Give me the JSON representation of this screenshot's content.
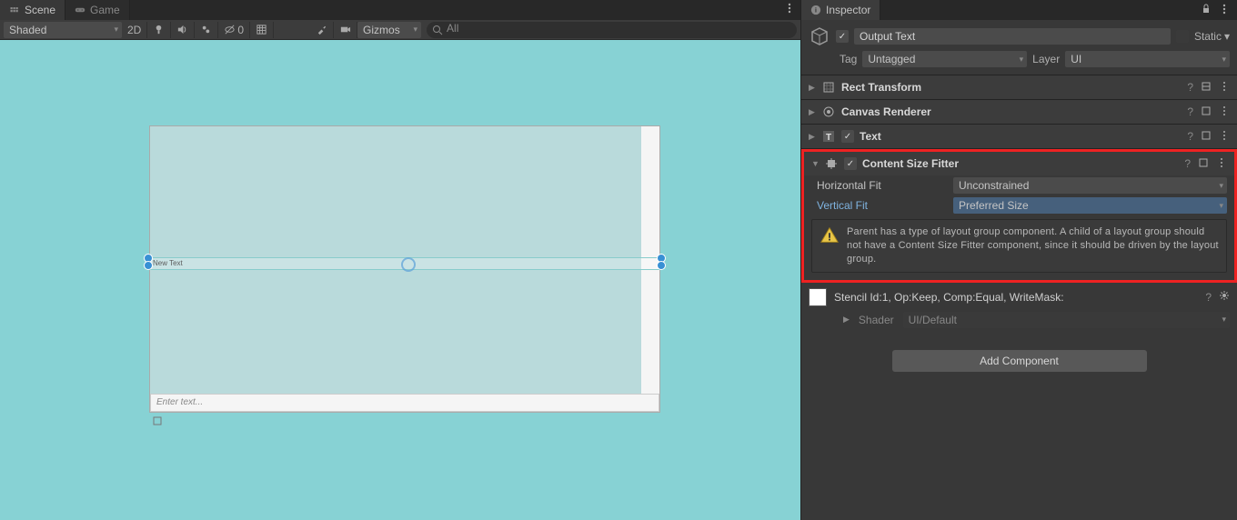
{
  "tabs": {
    "scene": "Scene",
    "game": "Game"
  },
  "toolbar": {
    "shading": "Shaded",
    "btn2d": "2D",
    "sky_hidden": "0",
    "gizmos": "Gizmos",
    "search_placeholder": "All"
  },
  "viewport": {
    "selected_text": "New Text",
    "input_placeholder": "Enter text..."
  },
  "inspector": {
    "title": "Inspector",
    "object_name": "Output Text",
    "static_label": "Static",
    "tag_label": "Tag",
    "tag_value": "Untagged",
    "layer_label": "Layer",
    "layer_value": "UI",
    "components": {
      "rect": "Rect Transform",
      "canvas_r": "Canvas Renderer",
      "text": "Text",
      "csf": "Content Size Fitter"
    },
    "csf": {
      "hfit_label": "Horizontal Fit",
      "hfit_value": "Unconstrained",
      "vfit_label": "Vertical Fit",
      "vfit_value": "Preferred Size",
      "warning": "Parent has a type of layout group component. A child of a layout group should not have a Content Size Fitter component, since it should be driven by the layout group."
    },
    "material": {
      "stencil": "Stencil Id:1, Op:Keep, Comp:Equal, WriteMask:",
      "shader_label": "Shader",
      "shader_value": "UI/Default"
    },
    "add_component": "Add Component"
  }
}
